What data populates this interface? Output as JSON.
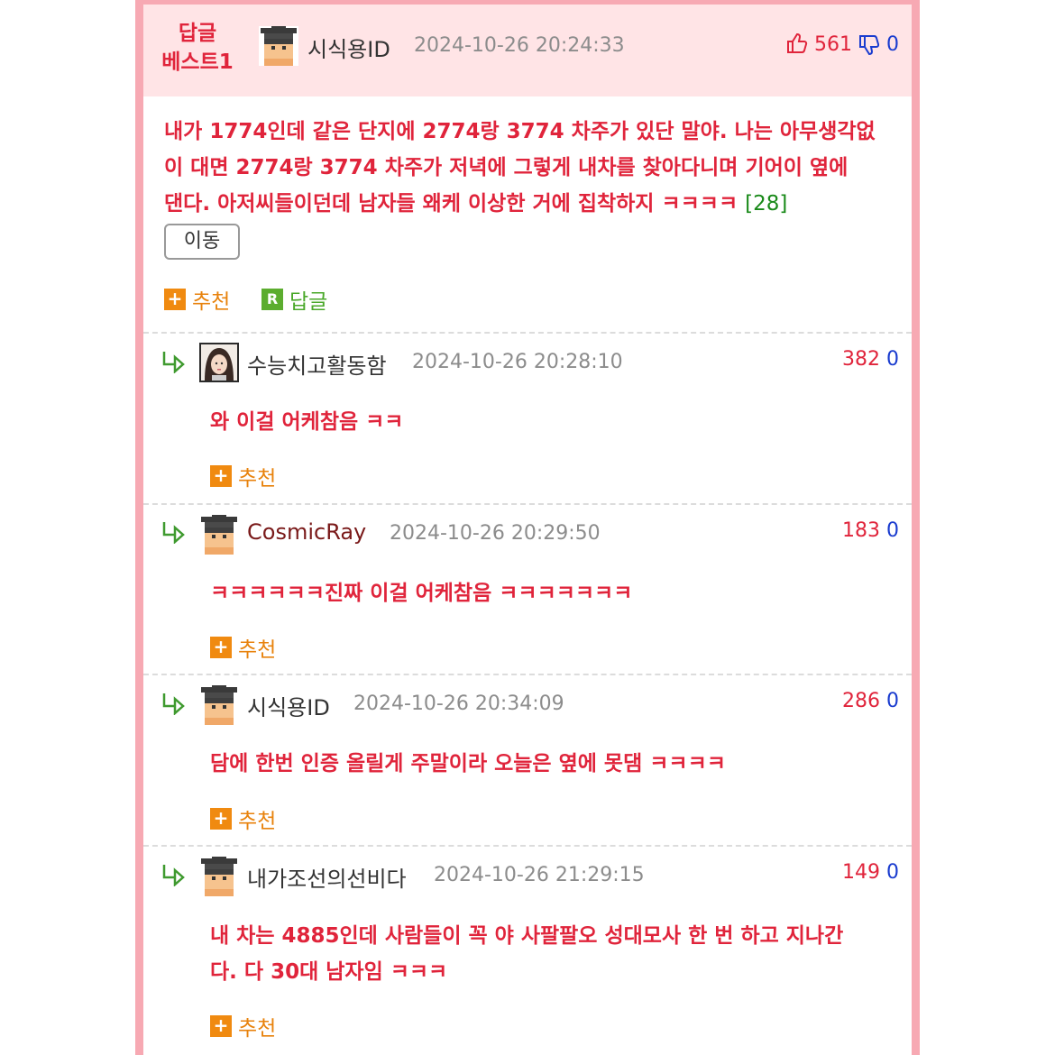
{
  "best": {
    "line1": "답글",
    "line2": "베스트1"
  },
  "top_post": {
    "nickname": "시식용ID",
    "date": "2024-10-26 20:24:33",
    "up": "561",
    "down": "0",
    "text_line1": "내가 1774인데 같은 단지에 2774랑 3774 차주가 있단 말야. 나는 아무생각없",
    "text_line2": "이 대면 2774랑 3774 차주가 저녁에 그렇게 내차를 찾아다니며 기어이 옆에",
    "text_line3": "댄다. 아저씨들이던데 남자들 왜케 이상한 거에 집착하지 ㅋㅋㅋㅋ",
    "reply_count": "[28]",
    "move_button": "이동",
    "recommend_label": "추천",
    "reply_label": "답글"
  },
  "replies": [
    {
      "nickname": "수능치고활동함",
      "date": "2024-10-26 20:28:10",
      "up": "382",
      "down": "0",
      "text_line1": "와 이걸 어케참음 ㅋㅋ",
      "text_line2": "",
      "recommend_label": "추천"
    },
    {
      "nickname": "CosmicRay",
      "date": "2024-10-26 20:29:50",
      "up": "183",
      "down": "0",
      "text_line1": "ㅋㅋㅋㅋㅋㅋ진짜 이걸 어케참음 ㅋㅋㅋㅋㅋㅋㅋ",
      "text_line2": "",
      "recommend_label": "추천"
    },
    {
      "nickname": "시식용ID",
      "date": "2024-10-26 20:34:09",
      "up": "286",
      "down": "0",
      "text_line1": "담에 한번 인증 올릴게 주말이라 오늘은 옆에 못댐 ㅋㅋㅋㅋ",
      "text_line2": "",
      "recommend_label": "추천"
    },
    {
      "nickname": "내가조선의선비다",
      "date": "2024-10-26 21:29:15",
      "up": "149",
      "down": "0",
      "text_line1": "내 차는 4885인데 사람들이 꼭 야 사팔팔오 성대모사 한 번 하고 지나간",
      "text_line2": "다. 다 30대 남자임 ㅋㅋㅋ",
      "recommend_label": "추천"
    }
  ],
  "colors": {
    "accent_red": "#e0243b",
    "down_blue": "#1a3ccf",
    "border_pink": "#f7a9b3",
    "header_bg": "#ffe4e6",
    "recommend_orange": "#f08a10"
  },
  "icons": {
    "thumbs_up": "thumbs-up-icon",
    "thumbs_down": "thumbs-down-icon",
    "reply_arrow": "reply-arrow-icon",
    "plus": "plus-icon",
    "reply_badge": "reply-badge-icon"
  }
}
